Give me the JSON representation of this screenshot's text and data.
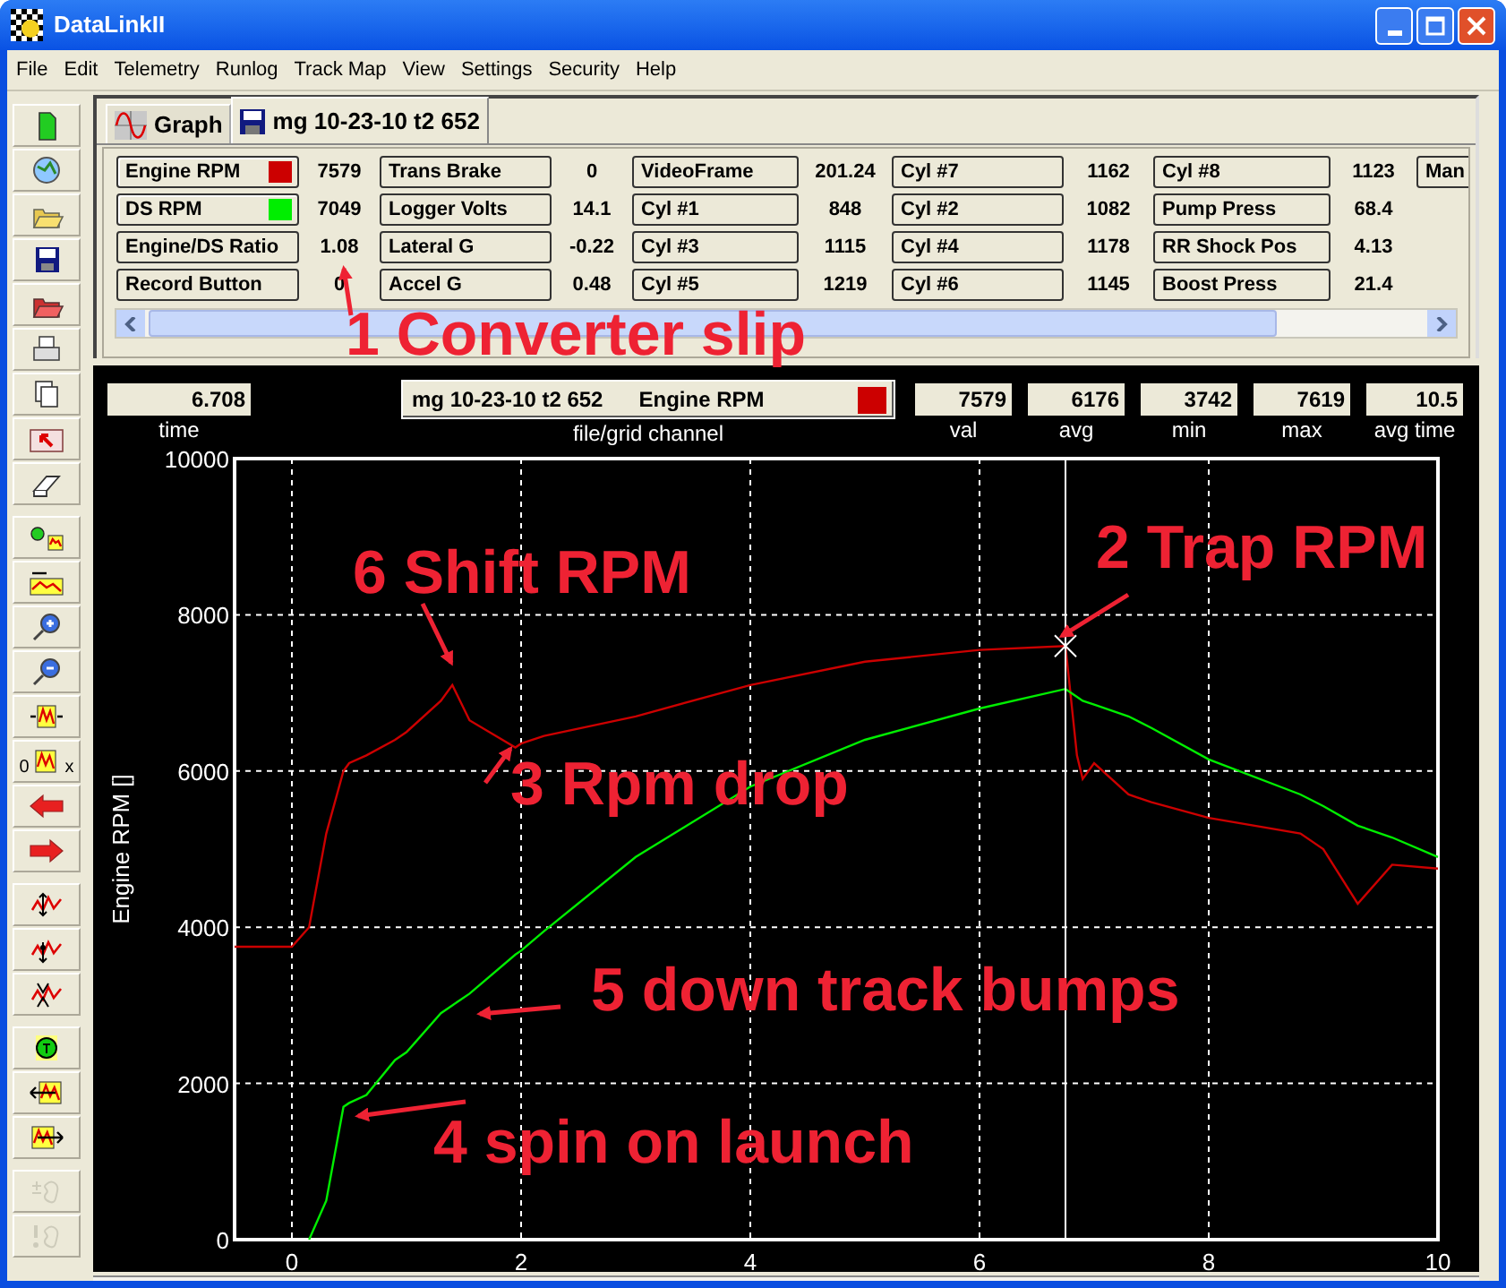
{
  "window": {
    "title": "DataLinkII"
  },
  "menu": [
    "File",
    "Edit",
    "Telemetry",
    "Runlog",
    "Track Map",
    "View",
    "Settings",
    "Security",
    "Help"
  ],
  "toolbar": [
    {
      "kind": "new",
      "disabled": false
    },
    {
      "kind": "globe",
      "disabled": false
    },
    {
      "kind": "open",
      "disabled": false
    },
    {
      "kind": "save",
      "disabled": false
    },
    {
      "kind": "openred",
      "disabled": false
    },
    {
      "kind": "print",
      "disabled": false
    },
    {
      "kind": "copy",
      "disabled": false
    },
    {
      "kind": "cursor",
      "disabled": false
    },
    {
      "kind": "erase",
      "disabled": false
    },
    {
      "kind": "overlay",
      "disabled": false
    },
    {
      "kind": "scroll",
      "disabled": false
    },
    {
      "kind": "zoomin",
      "disabled": false
    },
    {
      "kind": "zoomout",
      "disabled": false
    },
    {
      "kind": "widen",
      "disabled": false
    },
    {
      "kind": "range",
      "disabled": false,
      "labels": [
        "0",
        "x"
      ]
    },
    {
      "kind": "left",
      "disabled": false
    },
    {
      "kind": "right",
      "disabled": false
    },
    {
      "kind": "peakup",
      "disabled": false
    },
    {
      "kind": "peakdown",
      "disabled": false
    },
    {
      "kind": "peaklock",
      "disabled": false
    },
    {
      "kind": "timer",
      "disabled": false
    },
    {
      "kind": "moveleft",
      "disabled": false
    },
    {
      "kind": "moveright",
      "disabled": false
    },
    {
      "kind": "plusmap",
      "disabled": true
    },
    {
      "kind": "warnmap",
      "disabled": true
    }
  ],
  "tabs": [
    {
      "kind": "graph",
      "label": "Graph",
      "selected": false
    },
    {
      "kind": "file",
      "label": "mg 10-23-10 t2 652",
      "selected": true
    }
  ],
  "channels": [
    {
      "rows": [
        {
          "label": "Engine RPM",
          "value": "7579",
          "color": "#cc0000"
        },
        {
          "label": "DS RPM",
          "value": "7049",
          "color": "#00ee00"
        },
        {
          "label": "Engine/DS Ratio",
          "value": "1.08"
        },
        {
          "label": "Record Button",
          "value": "0"
        }
      ]
    },
    {
      "rows": [
        {
          "label": "Trans Brake",
          "value": "0"
        },
        {
          "label": "Logger Volts",
          "value": "14.1"
        },
        {
          "label": "Lateral G",
          "value": "-0.22"
        },
        {
          "label": "Accel G",
          "value": "0.48"
        }
      ]
    },
    {
      "rows": [
        {
          "label": "VideoFrame",
          "value": "201.24"
        },
        {
          "label": "Cyl #1",
          "value": "848"
        },
        {
          "label": "Cyl #3",
          "value": "1115"
        },
        {
          "label": "Cyl #5",
          "value": "1219"
        }
      ]
    },
    {
      "rows": [
        {
          "label": "Cyl #7",
          "value": "1162"
        },
        {
          "label": "Cyl #2",
          "value": "1082"
        },
        {
          "label": "Cyl #4",
          "value": "1178"
        },
        {
          "label": "Cyl #6",
          "value": "1145"
        }
      ]
    },
    {
      "rows": [
        {
          "label": "Cyl #8",
          "value": "1123"
        },
        {
          "label": "Pump Press",
          "value": "68.4"
        },
        {
          "label": "RR Shock Pos",
          "value": "4.13"
        },
        {
          "label": "Boost Press",
          "value": "21.4"
        }
      ]
    },
    {
      "rows": [
        {
          "label": "Man"
        }
      ]
    }
  ],
  "stats": {
    "time": {
      "value": "6.708",
      "label": "time"
    },
    "channel": {
      "file": "mg 10-23-10 t2 652",
      "name": "Engine RPM",
      "color": "#cc0000",
      "label": "file/grid channel"
    },
    "readings": [
      {
        "value": "7579",
        "label": "val"
      },
      {
        "value": "6176",
        "label": "avg"
      },
      {
        "value": "3742",
        "label": "min"
      },
      {
        "value": "7619",
        "label": "max"
      },
      {
        "value": "10.5",
        "label": "avg time"
      }
    ]
  },
  "graph": {
    "chart_data": {
      "type": "line",
      "grid": true,
      "ylabel": "Engine RPM []",
      "xlim": [
        -0.5,
        10
      ],
      "ylim": [
        0,
        10000
      ],
      "xticks": [
        0,
        2,
        4,
        6,
        8,
        10
      ],
      "yticks": [
        0,
        2000,
        4000,
        6000,
        8000,
        10000
      ],
      "x": [
        -0.5,
        0,
        0.15,
        0.3,
        0.45,
        0.5,
        0.65,
        0.9,
        1.0,
        1.3,
        1.4,
        1.55,
        1.95,
        2,
        2.2,
        3,
        4,
        5,
        6,
        6.75,
        6.85,
        6.9,
        7,
        7.3,
        7.5,
        8,
        8.8,
        9,
        9.3,
        9.6,
        10
      ],
      "series": [
        {
          "color": "#cc0000",
          "values": [
            3750,
            3750,
            4000,
            5200,
            6000,
            6100,
            6200,
            6400,
            6500,
            6900,
            7100,
            6650,
            6300,
            6350,
            6450,
            6700,
            7100,
            7400,
            7550,
            7600,
            6200,
            5900,
            6100,
            5700,
            5600,
            5400,
            5200,
            5000,
            4300,
            4800,
            4750
          ]
        },
        {
          "color": "#00ee00",
          "values": [
            null,
            null,
            0,
            500,
            1700,
            1750,
            1850,
            2300,
            2400,
            2900,
            3000,
            3150,
            3650,
            3700,
            3950,
            4900,
            5800,
            6400,
            6800,
            7050,
            6950,
            6900,
            6850,
            6700,
            6550,
            6150,
            5700,
            5550,
            5300,
            5150,
            4900
          ]
        }
      ],
      "ref_lines": [
        {
          "axis": "x",
          "value": 6.75,
          "color": "#ffffff"
        }
      ]
    }
  },
  "callouts": [
    "1 Converter slip",
    "2 Trap RPM",
    "3 Rpm drop",
    "4 spin on launch",
    "5 down track bumps",
    "6 Shift RPM"
  ]
}
